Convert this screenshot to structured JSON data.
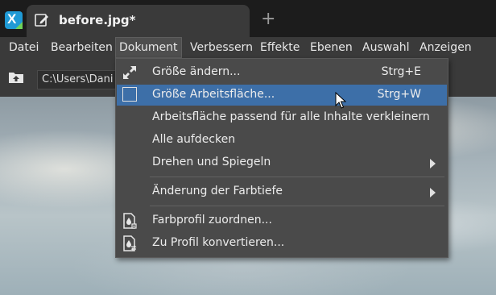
{
  "tab": {
    "title": "before.jpg*",
    "add_label": "+"
  },
  "menubar": {
    "items": [
      "Datei",
      "Bearbeiten",
      "Dokument",
      "Verbessern",
      "Effekte",
      "Ebenen",
      "Auswahl",
      "Anzeigen"
    ],
    "active": "Dokument"
  },
  "pathbar": {
    "path_value": "C:\\Users\\Dani"
  },
  "dropdown": {
    "items": [
      {
        "label": "Größe ändern...",
        "shortcut": "Strg+E",
        "icon": "resize-arrows-icon"
      },
      {
        "label": "Größe Arbeitsfläche...",
        "shortcut": "Strg+W",
        "icon": "canvas-size-icon",
        "hovered": true
      },
      {
        "label": "Arbeitsfläche passend für alle Inhalte verkleinern"
      },
      {
        "label": "Alle aufdecken"
      },
      {
        "label": "Drehen und Spiegeln",
        "submenu": true
      },
      {
        "label": "Änderung der Farbtiefe",
        "submenu": true
      },
      {
        "label": "Farbprofil zuordnen...",
        "icon": "color-profile-icon"
      },
      {
        "label": "Zu Profil konvertieren...",
        "icon": "convert-profile-icon"
      }
    ]
  },
  "colors": {
    "hover": "#3d6fa8",
    "menu_bg": "#4a4a4a",
    "bar_bg": "#3a3a3a",
    "app_accent": "#1f9ad6"
  }
}
